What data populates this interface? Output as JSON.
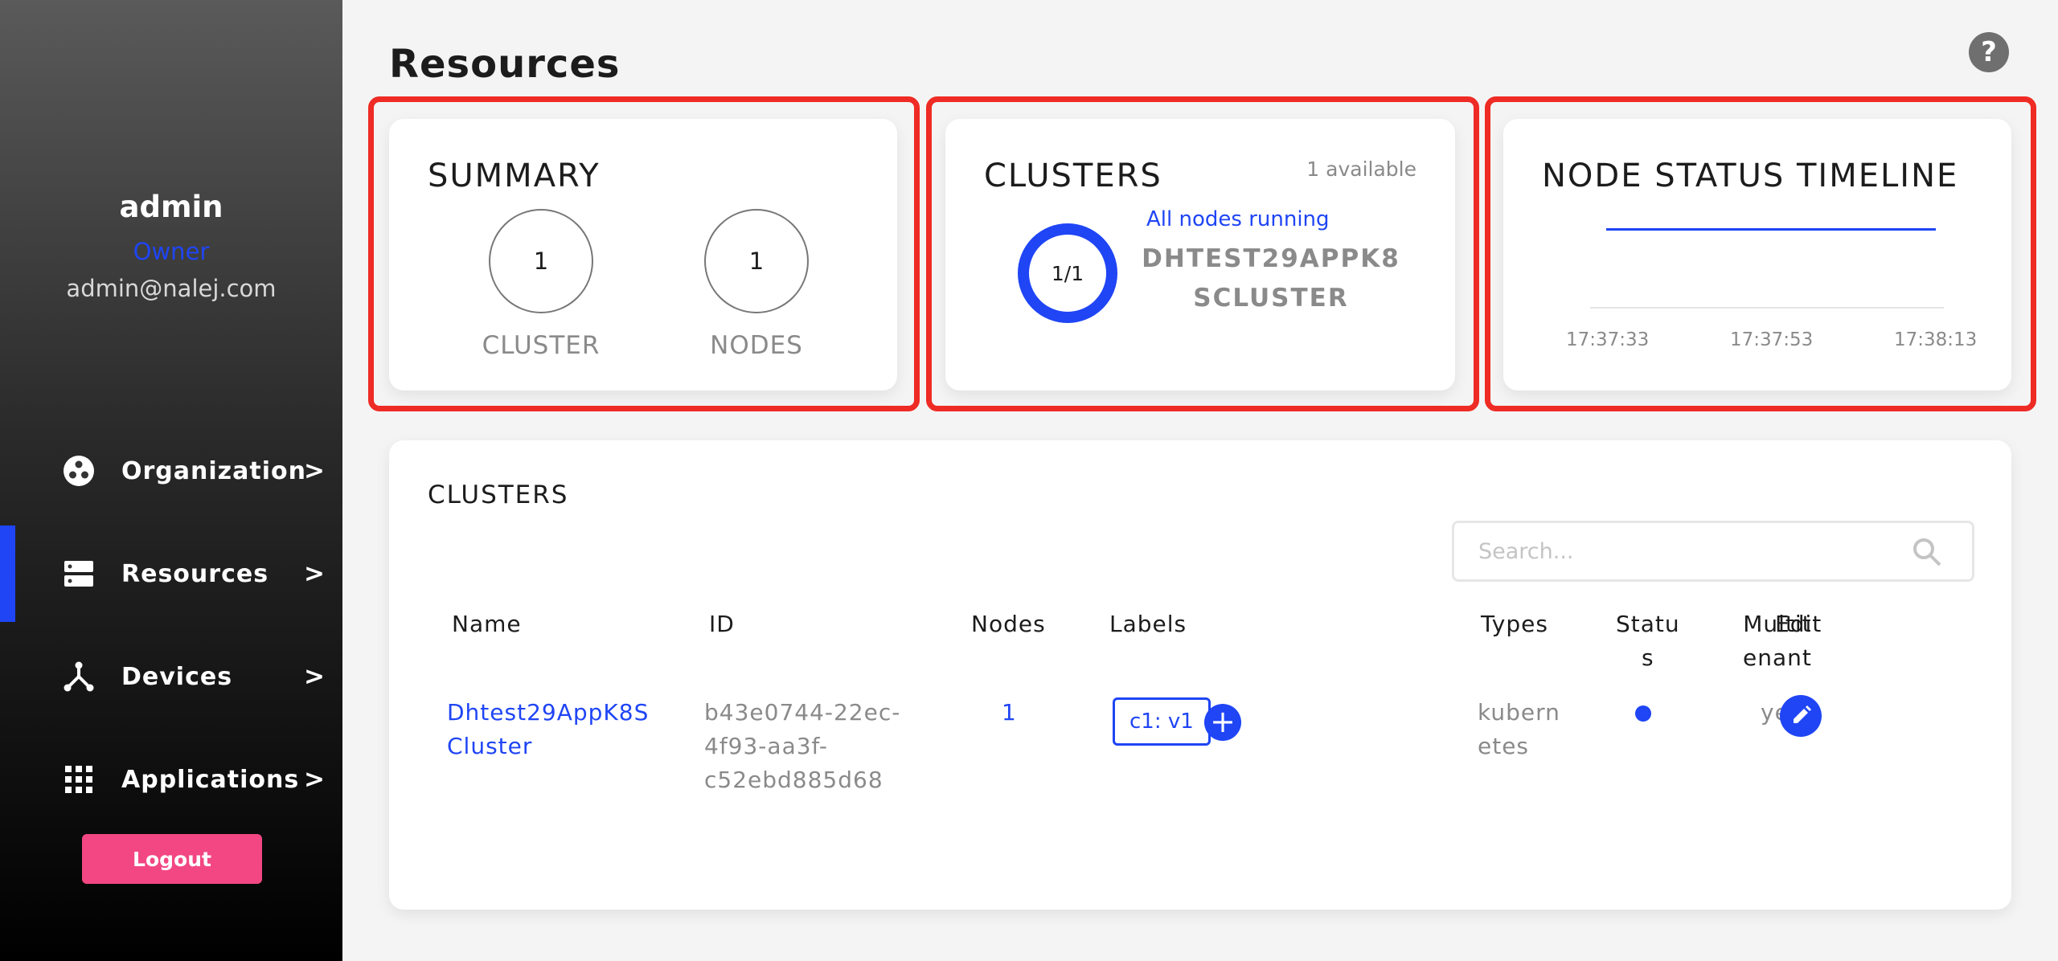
{
  "sidebar": {
    "user_name": "admin",
    "user_role": "Owner",
    "user_email": "admin@nalej.com",
    "items": [
      {
        "label": "Organization",
        "icon": "organization-icon",
        "arrow": ">"
      },
      {
        "label": "Resources",
        "icon": "resources-icon",
        "arrow": ">",
        "active": true
      },
      {
        "label": "Devices",
        "icon": "devices-icon",
        "arrow": ">"
      },
      {
        "label": "Applications",
        "icon": "applications-icon",
        "arrow": ">"
      }
    ],
    "logout_label": "Logout"
  },
  "header": {
    "title": "Resources",
    "help_label": "?"
  },
  "summary": {
    "title": "SUMMARY",
    "cluster_count": "1",
    "cluster_label": "CLUSTER",
    "nodes_count": "1",
    "nodes_label": "NODES"
  },
  "clusters_card": {
    "title": "CLUSTERS",
    "available": "1 available",
    "ratio": "1/1",
    "status_text": "All nodes running",
    "cluster_name_line1": "DHTEST29APPK8",
    "cluster_name_line2": "SCLUSTER"
  },
  "timeline": {
    "title": "NODE STATUS TIMELINE",
    "ticks": [
      "17:37:33",
      "17:37:53",
      "17:38:13"
    ]
  },
  "clusters_table": {
    "title": "CLUSTERS",
    "search_placeholder": "Search...",
    "headers": {
      "name": "Name",
      "id": "ID",
      "nodes": "Nodes",
      "labels": "Labels",
      "types": "Types",
      "status_1": "Statu",
      "status_2": "s",
      "multitenant_1": "Multit",
      "multitenant_2": "enant",
      "edit": "Edit"
    },
    "rows": [
      {
        "name_1": "Dhtest29AppK8S",
        "name_2": "Cluster",
        "id_1": "b43e0744-22ec-",
        "id_2": "4f93-aa3f-",
        "id_3": "c52ebd885d68",
        "nodes": "1",
        "label": "c1: v1",
        "type_1": "kubern",
        "type_2": "etes",
        "status": "running",
        "multitenant": "yes"
      }
    ]
  },
  "colors": {
    "accent": "#1f45f5",
    "logout": "#f24782",
    "highlight": "#ee2b24"
  }
}
